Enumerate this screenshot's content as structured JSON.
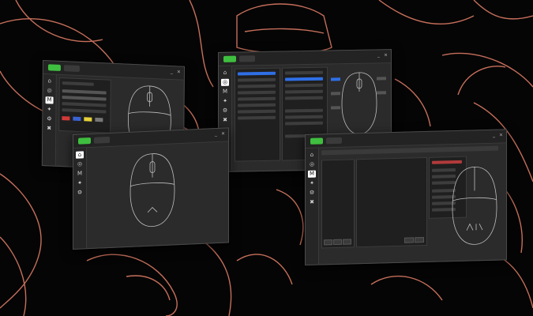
{
  "colors": {
    "background": "#050505",
    "outline_accent": "#e8826a",
    "window_bg": "#2b2b2b",
    "tab_green": "#3fbf3f",
    "select_blue": "#2f6fe6",
    "swatch_red": "#d23a3a",
    "swatch_blue": "#3a63d2",
    "swatch_yellow": "#e6d23a"
  },
  "windows": [
    {
      "id": "lighting-window",
      "logo": "",
      "sidebar_icons": [
        "home-icon",
        "pointer-icon",
        "m-icon",
        "lighting-icon",
        "gear-icon",
        "tools-icon"
      ],
      "footer": "",
      "window_controls": [
        "_",
        "×"
      ]
    },
    {
      "id": "button-mapping-window",
      "logo": "",
      "sidebar_icons": [
        "home-icon",
        "pointer-icon",
        "m-icon",
        "lighting-icon",
        "gear-icon",
        "tools-icon"
      ],
      "footer": "",
      "window_controls": [
        "_",
        "×"
      ]
    },
    {
      "id": "home-window",
      "logo": "",
      "sidebar_icons": [
        "home-icon",
        "pointer-icon",
        "m-icon",
        "lighting-icon",
        "gear-icon"
      ],
      "footer": "",
      "window_controls": [
        "_",
        "×"
      ]
    },
    {
      "id": "macro-window",
      "logo": "",
      "sidebar_icons": [
        "home-icon",
        "pointer-icon",
        "m-icon",
        "lighting-icon",
        "gear-icon",
        "tools-icon"
      ],
      "footer": "",
      "window_controls": [
        "_",
        "×"
      ]
    }
  ],
  "icons": {
    "home": "⌂",
    "pointer": "◎",
    "m": "M",
    "lighting": "✦",
    "gear": "⚙",
    "tools": "✖",
    "minimize": "_",
    "close": "×"
  }
}
